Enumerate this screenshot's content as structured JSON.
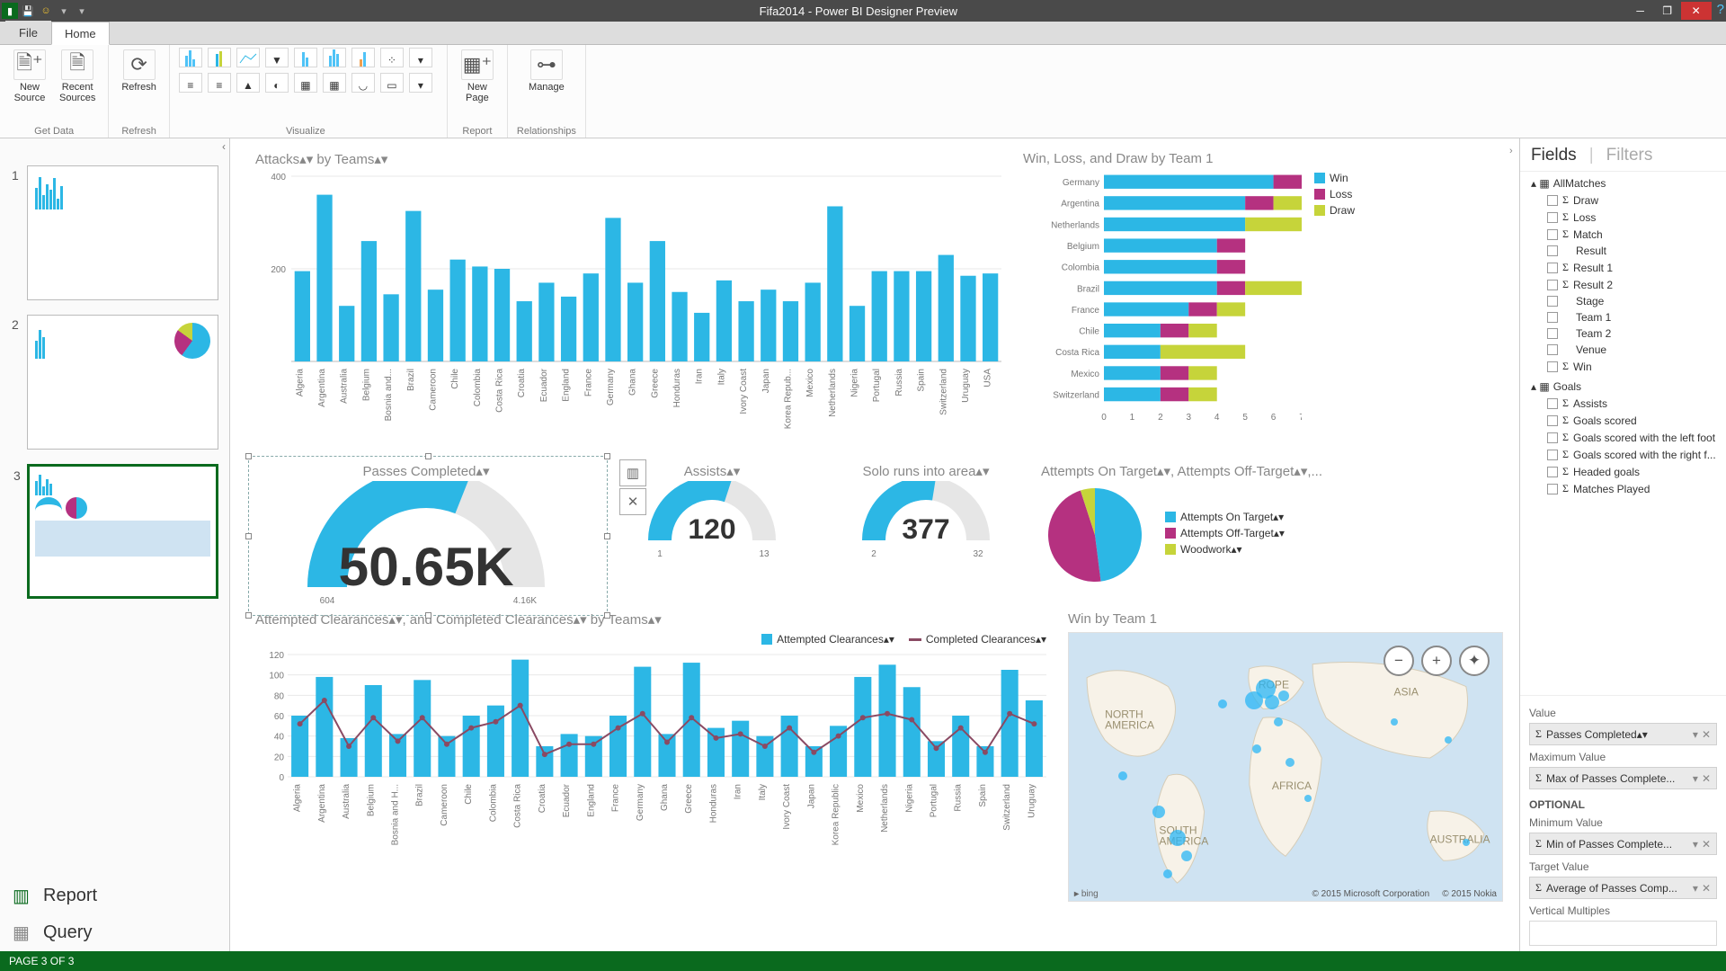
{
  "app": {
    "title": "Fifa2014 - Power BI Designer Preview"
  },
  "tabs": {
    "file": "File",
    "home": "Home"
  },
  "ribbon": {
    "new_source": "New\nSource",
    "recent": "Recent\nSources",
    "refresh": "Refresh",
    "get_data": "Get Data",
    "refresh_grp": "Refresh",
    "visualize": "Visualize",
    "new_page": "New\nPage",
    "report": "Report",
    "manage": "Manage",
    "relationships": "Relationships"
  },
  "thumbs": {
    "n1": "1",
    "n2": "2",
    "n3": "3"
  },
  "view": {
    "report": "Report",
    "query": "Query"
  },
  "attacks": {
    "title": "Attacks▴▾ by Teams▴▾",
    "ymax": 400,
    "yticks": [
      400,
      200
    ],
    "categories": [
      "Algeria",
      "Argentina",
      "Australia",
      "Belgium",
      "Bosnia and...",
      "Brazil",
      "Cameroon",
      "Chile",
      "Colombia",
      "Costa Rica",
      "Croatia",
      "Ecuador",
      "England",
      "France",
      "Germany",
      "Ghana",
      "Greece",
      "Honduras",
      "Iran",
      "Italy",
      "Ivory Coast",
      "Japan",
      "Korea Repub...",
      "Mexico",
      "Netherlands",
      "Nigeria",
      "Portugal",
      "Russia",
      "Spain",
      "Switzerland",
      "Uruguay",
      "USA"
    ],
    "values": [
      195,
      360,
      120,
      260,
      145,
      325,
      155,
      220,
      205,
      200,
      130,
      170,
      140,
      190,
      310,
      170,
      260,
      150,
      105,
      175,
      130,
      155,
      130,
      170,
      335,
      120,
      195,
      195,
      195,
      230,
      185,
      190
    ]
  },
  "wld": {
    "title": "Win, Loss, and Draw by Team 1",
    "teams": [
      "Germany",
      "Argentina",
      "Netherlands",
      "Belgium",
      "Colombia",
      "Brazil",
      "France",
      "Chile",
      "Costa Rica",
      "Mexico",
      "Switzerland"
    ],
    "win": [
      6,
      5,
      5,
      4,
      4,
      4,
      3,
      2,
      2,
      2,
      2
    ],
    "loss": [
      1,
      1,
      0,
      1,
      1,
      1,
      1,
      1,
      0,
      1,
      1
    ],
    "draw": [
      0,
      1,
      2,
      0,
      0,
      2,
      1,
      1,
      3,
      1,
      1
    ],
    "xticks": [
      0,
      1,
      2,
      3,
      4,
      5,
      6,
      7
    ],
    "legend": {
      "win": "Win",
      "loss": "Loss",
      "draw": "Draw"
    },
    "colors": {
      "win": "#2cb7e5",
      "loss": "#b53180",
      "draw": "#c6d43a"
    }
  },
  "gauges": {
    "passes": {
      "title": "Passes Completed▴▾",
      "value": "50.65K",
      "min": "604",
      "max": "4.16K",
      "frac": 0.62
    },
    "assists": {
      "title": "Assists▴▾",
      "value": "120",
      "min": "1",
      "max": "13",
      "frac": 0.6
    },
    "solo": {
      "title": "Solo runs into area▴▾",
      "value": "377",
      "min": "2",
      "max": "32",
      "frac": 0.55
    }
  },
  "attempts": {
    "title": "Attempts On Target▴▾, Attempts Off-Target▴▾,...",
    "legend": [
      "Attempts On Target▴▾",
      "Attempts Off-Target▴▾",
      "Woodwork▴▾"
    ],
    "colors": [
      "#2cb7e5",
      "#b53180",
      "#c6d43a"
    ],
    "slices": [
      0.48,
      0.47,
      0.05
    ]
  },
  "clear": {
    "title": "Attempted Clearances▴▾, and Completed Clearances▴▾ by Teams▴▾",
    "legend": {
      "a": "Attempted Clearances▴▾",
      "c": "Completed Clearances▴▾"
    },
    "ymax": 120,
    "yticks": [
      120,
      100,
      80,
      60,
      40,
      20,
      0
    ],
    "categories": [
      "Algeria",
      "Argentina",
      "Australia",
      "Belgium",
      "Bosnia and H...",
      "Brazil",
      "Cameroon",
      "Chile",
      "Colombia",
      "Costa Rica",
      "Croatia",
      "Ecuador",
      "England",
      "France",
      "Germany",
      "Ghana",
      "Greece",
      "Honduras",
      "Iran",
      "Italy",
      "Ivory Coast",
      "Japan",
      "Korea Republic",
      "Mexico",
      "Netherlands",
      "Nigeria",
      "Portugal",
      "Russia",
      "Spain",
      "Switzerland",
      "Uruguay"
    ],
    "attempted": [
      60,
      98,
      38,
      90,
      42,
      95,
      40,
      60,
      70,
      115,
      30,
      42,
      40,
      60,
      108,
      42,
      112,
      48,
      55,
      40,
      60,
      30,
      50,
      98,
      110,
      88,
      35,
      60,
      30,
      105,
      75
    ],
    "completed": [
      52,
      75,
      30,
      58,
      35,
      58,
      32,
      48,
      54,
      70,
      22,
      32,
      32,
      48,
      62,
      34,
      58,
      38,
      42,
      30,
      48,
      24,
      40,
      58,
      62,
      56,
      28,
      48,
      24,
      62,
      52
    ]
  },
  "map": {
    "title": "Win by Team 1",
    "labels": {
      "na": "NORTH\nAMERICA",
      "sa": "SOUTH\nAMERICA",
      "eu": "ROPE",
      "af": "AFRICA",
      "as": "ASIA",
      "au": "AUSTRALIA"
    },
    "attr": {
      "bing": "bing",
      "ms": "© 2015 Microsoft Corporation",
      "nokia": "© 2015 Nokia"
    }
  },
  "fields": {
    "header": {
      "fields": "Fields",
      "filters": "Filters"
    },
    "tables": {
      "allmatches": {
        "name": "AllMatches",
        "items": [
          "Draw",
          "Loss",
          "Match",
          "Result",
          "Result 1",
          "Result 2",
          "Stage",
          "Team 1",
          "Team 2",
          "Venue",
          "Win"
        ],
        "sigma": [
          true,
          true,
          true,
          false,
          true,
          true,
          false,
          false,
          false,
          false,
          true
        ]
      },
      "goals": {
        "name": "Goals",
        "items": [
          "Assists",
          "Goals scored",
          "Goals scored with the left foot",
          "Goals scored with the right f...",
          "Headed goals",
          "Matches Played"
        ],
        "sigma": [
          true,
          true,
          true,
          true,
          true,
          true
        ]
      }
    },
    "wells": {
      "value": {
        "label": "Value",
        "item": "Passes Completed▴▾"
      },
      "max": {
        "label": "Maximum Value",
        "item": "Max of Passes Complete..."
      },
      "optional": "OPTIONAL",
      "min": {
        "label": "Minimum Value",
        "item": "Min of Passes Complete..."
      },
      "target": {
        "label": "Target Value",
        "item": "Average of Passes Comp..."
      },
      "vmult": {
        "label": "Vertical Multiples"
      }
    }
  },
  "status": {
    "page": "PAGE 3 OF 3"
  },
  "chart_data": [
    {
      "type": "bar",
      "title": "Attacks by Teams",
      "ylim": [
        0,
        400
      ],
      "categories": [
        "Algeria",
        "Argentina",
        "Australia",
        "Belgium",
        "Bosnia and Herzegovina",
        "Brazil",
        "Cameroon",
        "Chile",
        "Colombia",
        "Costa Rica",
        "Croatia",
        "Ecuador",
        "England",
        "France",
        "Germany",
        "Ghana",
        "Greece",
        "Honduras",
        "Iran",
        "Italy",
        "Ivory Coast",
        "Japan",
        "Korea Republic",
        "Mexico",
        "Netherlands",
        "Nigeria",
        "Portugal",
        "Russia",
        "Spain",
        "Switzerland",
        "Uruguay",
        "USA"
      ],
      "values": [
        195,
        360,
        120,
        260,
        145,
        325,
        155,
        220,
        205,
        200,
        130,
        170,
        140,
        190,
        310,
        170,
        260,
        150,
        105,
        175,
        130,
        155,
        130,
        170,
        335,
        120,
        195,
        195,
        195,
        230,
        185,
        190
      ]
    },
    {
      "type": "bar",
      "title": "Win, Loss, and Draw by Team 1",
      "orientation": "h",
      "stacked": true,
      "xlim": [
        0,
        7
      ],
      "categories": [
        "Germany",
        "Argentina",
        "Netherlands",
        "Belgium",
        "Colombia",
        "Brazil",
        "France",
        "Chile",
        "Costa Rica",
        "Mexico",
        "Switzerland"
      ],
      "series": [
        {
          "name": "Win",
          "values": [
            6,
            5,
            5,
            4,
            4,
            4,
            3,
            2,
            2,
            2,
            2
          ]
        },
        {
          "name": "Loss",
          "values": [
            1,
            1,
            0,
            1,
            1,
            1,
            1,
            1,
            0,
            1,
            1
          ]
        },
        {
          "name": "Draw",
          "values": [
            0,
            1,
            2,
            0,
            0,
            2,
            1,
            1,
            3,
            1,
            1
          ]
        }
      ]
    },
    {
      "type": "pie",
      "title": "Attempts On Target, Attempts Off-Target, Woodwork",
      "categories": [
        "Attempts On Target",
        "Attempts Off-Target",
        "Woodwork"
      ],
      "values": [
        0.48,
        0.47,
        0.05
      ]
    },
    {
      "type": "bar",
      "title": "Attempted Clearances and Completed Clearances by Teams",
      "ylim": [
        0,
        120
      ],
      "categories": [
        "Algeria",
        "Argentina",
        "Australia",
        "Belgium",
        "Bosnia and Herzegovina",
        "Brazil",
        "Cameroon",
        "Chile",
        "Colombia",
        "Costa Rica",
        "Croatia",
        "Ecuador",
        "England",
        "France",
        "Germany",
        "Ghana",
        "Greece",
        "Honduras",
        "Iran",
        "Italy",
        "Ivory Coast",
        "Japan",
        "Korea Republic",
        "Mexico",
        "Netherlands",
        "Nigeria",
        "Portugal",
        "Russia",
        "Spain",
        "Switzerland",
        "Uruguay"
      ],
      "series": [
        {
          "name": "Attempted Clearances",
          "values": [
            60,
            98,
            38,
            90,
            42,
            95,
            40,
            60,
            70,
            115,
            30,
            42,
            40,
            60,
            108,
            42,
            112,
            48,
            55,
            40,
            60,
            30,
            50,
            98,
            110,
            88,
            35,
            60,
            30,
            105,
            75
          ]
        },
        {
          "name": "Completed Clearances",
          "values": [
            52,
            75,
            30,
            58,
            35,
            58,
            32,
            48,
            54,
            70,
            22,
            32,
            32,
            48,
            62,
            34,
            58,
            38,
            42,
            30,
            48,
            24,
            40,
            58,
            62,
            56,
            28,
            48,
            24,
            62,
            52
          ]
        }
      ]
    }
  ]
}
